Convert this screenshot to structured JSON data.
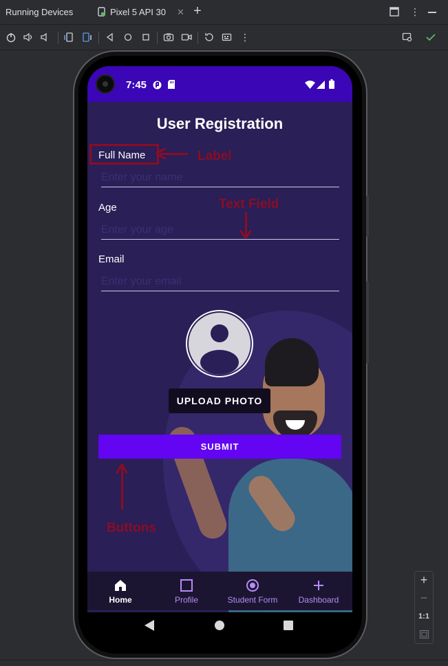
{
  "ide": {
    "panel_title": "Running Devices",
    "device_tab": "Pixel 5 API 30",
    "zoom_ratio": "1:1"
  },
  "status": {
    "time": "7:45"
  },
  "form": {
    "heading": "User Registration",
    "fields": [
      {
        "label": "Full Name",
        "placeholder": "Enter your name"
      },
      {
        "label": "Age",
        "placeholder": "Enter your age"
      },
      {
        "label": "Email",
        "placeholder": "Enter your email"
      }
    ],
    "upload_label": "UPLOAD PHOTO",
    "submit_label": "SUBMIT"
  },
  "annotations": {
    "label": "Label",
    "text_field": "Text Field",
    "buttons": "Buttons",
    "color": "#8a0d26"
  },
  "nav": {
    "items": [
      {
        "label": "Home",
        "icon": "home-icon",
        "active": true
      },
      {
        "label": "Profile",
        "icon": "square-icon",
        "active": false
      },
      {
        "label": "Student Form",
        "icon": "radio-icon",
        "active": false
      },
      {
        "label": "Dashboard",
        "icon": "plus-icon",
        "active": false
      }
    ]
  },
  "colors": {
    "status_bar": "#3a06b6",
    "screen_bg": "#2a1f56",
    "submit_button": "#6304f2",
    "nav_accent": "#b58cf5"
  }
}
